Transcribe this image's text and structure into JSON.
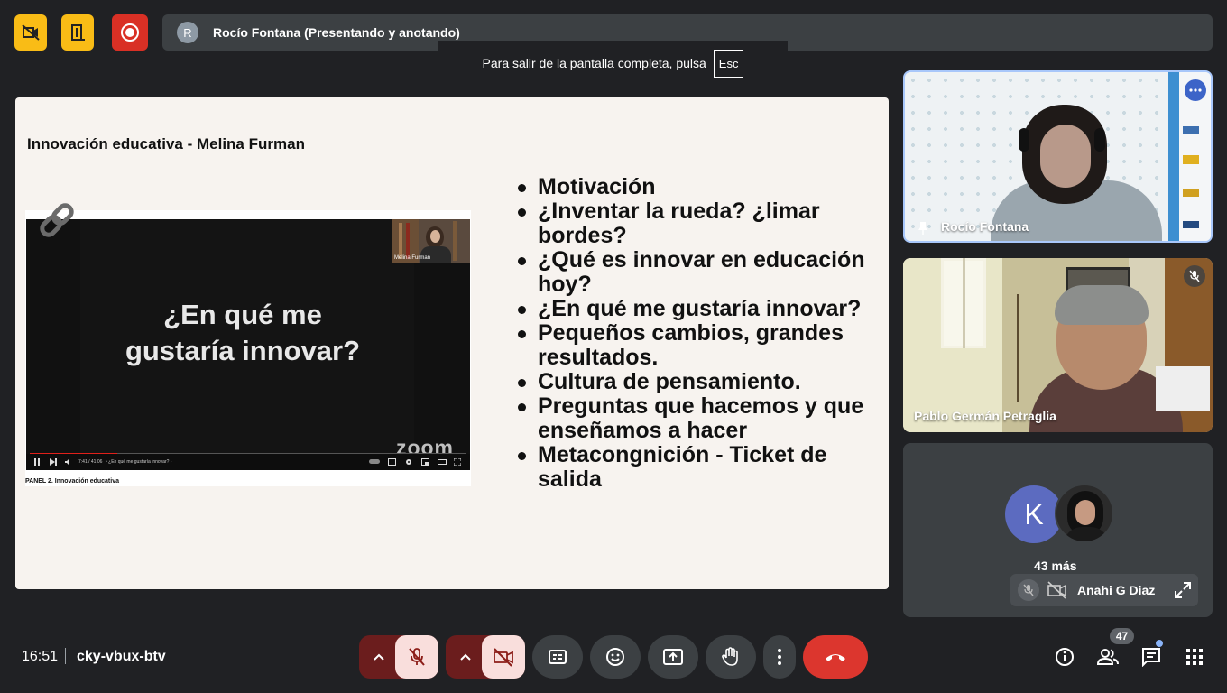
{
  "top_bar": {
    "presenter_initial": "R",
    "presenter_label": "Rocío Fontana (Presentando y anotando)",
    "fullscreen_hint": "Para salir de la pantalla completa, pulsa",
    "esc_key": "Esc"
  },
  "slide": {
    "title": "Innovación educativa - Melina Furman",
    "video_text_line1": "¿En qué me",
    "video_text_line2": "gustaría innovar?",
    "pip_label": "Melina Furman",
    "zoom_logo": "zoom",
    "video_time": "7:41 / 41:06",
    "video_chapter": "• ¿En qué me gustaría innovar?  ›",
    "video_caption": "PANEL 2. Innovación educativa",
    "video_progress": 0.2,
    "bullets": [
      "Motivación",
      "¿Inventar la rueda? ¿limar bordes?",
      "¿Qué es innovar en educación hoy?",
      "¿En qué me gustaría innovar?",
      "Pequeños cambios, grandes resultados.",
      "Cultura de pensamiento.",
      "Preguntas que hacemos y que enseñamos a hacer",
      "Metacongnición - Ticket de salida"
    ]
  },
  "participants": {
    "tile1_name": "Rocío Fontana",
    "tile2_name": "Pablo Germán Petraglia",
    "group_initial": "K",
    "group_more": "43 más",
    "group_active_name": "Anahi G Diaz"
  },
  "bottom_bar": {
    "time": "16:51",
    "meeting_code": "cky-vbux-btv",
    "participant_count": "47"
  },
  "colors": {
    "background": "#202124",
    "tile": "#3c4043",
    "yellow_button": "#f9bc16",
    "record_red": "#d93025",
    "hangup_red": "#dc362e",
    "off_state": "#f9dedc",
    "off_group": "#6b1d1d",
    "slide_bg": "#f7f3ef"
  }
}
